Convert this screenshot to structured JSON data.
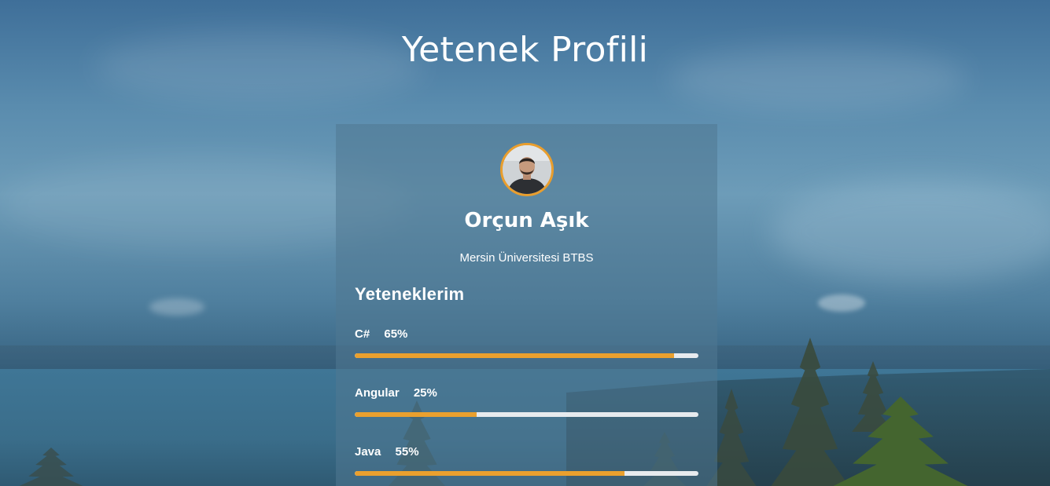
{
  "page": {
    "title": "Yetenek Profili"
  },
  "profile": {
    "name": "Orçun Aşık",
    "subtitle": "Mersin Üniversitesi BTBS",
    "avatar_icon": "person-photo"
  },
  "skills_section": {
    "heading": "Yeteneklerim",
    "items": [
      {
        "name": "C#",
        "percent_label": "65%",
        "bar_fill": 0.93
      },
      {
        "name": "Angular",
        "percent_label": "25%",
        "bar_fill": 0.355
      },
      {
        "name": "Java",
        "percent_label": "55%",
        "bar_fill": 0.785
      }
    ]
  },
  "colors": {
    "accent": "#eaa02e",
    "bar_track": "#e7eaee",
    "text": "#ffffff"
  }
}
